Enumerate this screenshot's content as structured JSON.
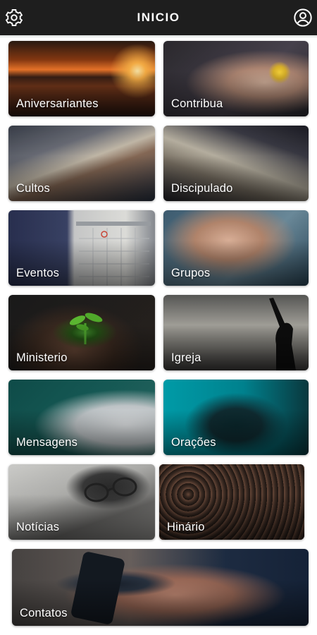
{
  "header": {
    "title": "INICIO",
    "settings_icon": "gear-icon",
    "profile_icon": "user-circle-icon",
    "background": "#1e1e1e"
  },
  "tiles": [
    {
      "label": "Aniversariantes"
    },
    {
      "label": "Contribua"
    },
    {
      "label": "Cultos"
    },
    {
      "label": "Discipulado"
    },
    {
      "label": "Eventos"
    },
    {
      "label": "Grupos"
    },
    {
      "label": "Ministerio"
    },
    {
      "label": "Igreja"
    },
    {
      "label": "Mensagens"
    },
    {
      "label": "Orações"
    },
    {
      "label": "Notícias"
    },
    {
      "label": "Hinário"
    },
    {
      "label": "Contatos"
    }
  ]
}
